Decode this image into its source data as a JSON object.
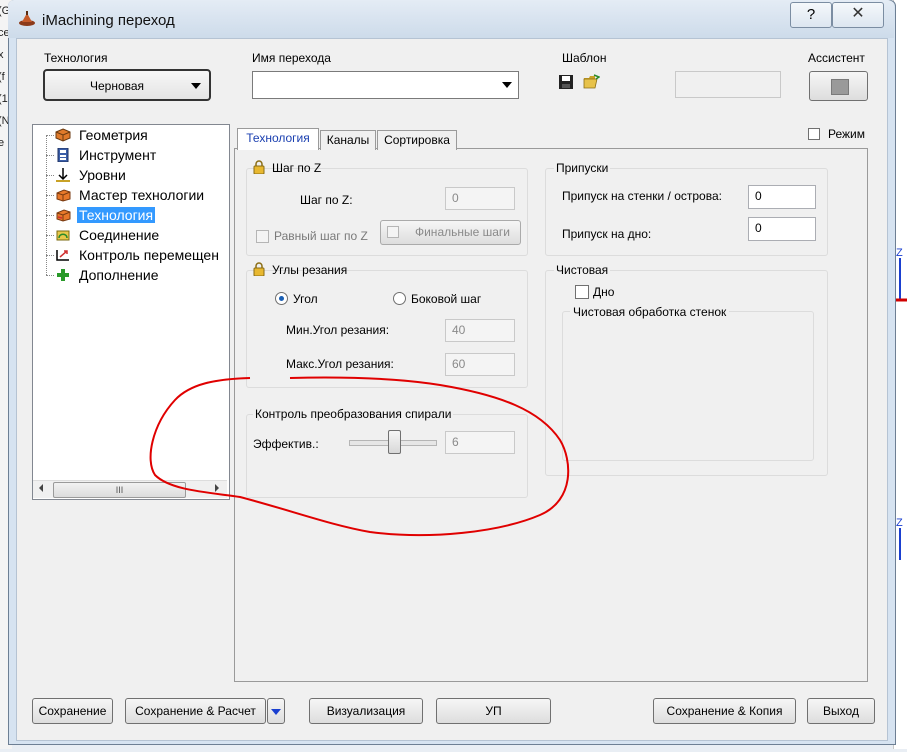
{
  "window": {
    "title": "iMachining переход",
    "help": "?",
    "close": "✕"
  },
  "background": {
    "left_lines": [
      "(G",
      "ce",
      "x",
      "(f",
      "(1",
      "(N",
      "e"
    ]
  },
  "top": {
    "technology_label": "Технология",
    "technology_value": "Черновая",
    "operation_name_label": "Имя перехода",
    "operation_name_value": "",
    "template_label": "Шаблон",
    "assistant_label": "Ассистент"
  },
  "tree": {
    "items": [
      {
        "label": "Геометрия",
        "icon": "geometry-icon"
      },
      {
        "label": "Инструмент",
        "icon": "tool-icon"
      },
      {
        "label": "Уровни",
        "icon": "levels-icon"
      },
      {
        "label": "Мастер технологии",
        "icon": "wizard-icon"
      },
      {
        "label": "Технология",
        "icon": "technology-icon",
        "selected": true
      },
      {
        "label": "Соединение",
        "icon": "link-icon"
      },
      {
        "label": "Контроль перемещен",
        "icon": "motion-control-icon"
      },
      {
        "label": "Дополнение",
        "icon": "misc-plus-icon"
      }
    ],
    "scroll_label": "III"
  },
  "mode": {
    "label": "Режим",
    "checked": false
  },
  "tabs": [
    {
      "label": "Технология",
      "active": true
    },
    {
      "label": "Каналы",
      "active": false
    },
    {
      "label": "Сортировка",
      "active": false
    }
  ],
  "step_z": {
    "title": "Шаг по Z",
    "field_label": "Шаг по Z:",
    "field_value": "0",
    "equal_step_label": "Равный шаг по Z",
    "final_steps_label": "Финальные шаги"
  },
  "cut_angles": {
    "title": "Углы резания",
    "angle_label": "Угол",
    "side_step_label": "Боковой шаг",
    "min_label": "Мин.Угол резания:",
    "min_value": "40",
    "max_label": "Макс.Угол резания:",
    "max_value": "60"
  },
  "spiral": {
    "title": "Контроль преобразования спирали",
    "efficiency_label": "Эффектив.:",
    "efficiency_value": "6"
  },
  "allowances": {
    "title": "Припуски",
    "walls_label": "Припуск на стенки / острова:",
    "walls_value": "0",
    "floor_label": "Припуск на дно:",
    "floor_value": "0"
  },
  "finish": {
    "title": "Чистовая",
    "floor_label": "Дно",
    "walls_title": "Чистовая обработка стенок"
  },
  "buttons": {
    "save": "Сохранение",
    "save_calc": "Сохранение & Расчет",
    "visualize": "Визуализация",
    "gcode": "УП",
    "save_copy": "Сохранение & Копия",
    "exit": "Выход"
  },
  "colors": {
    "selection": "#3399ff",
    "annotation": "#e00000"
  }
}
